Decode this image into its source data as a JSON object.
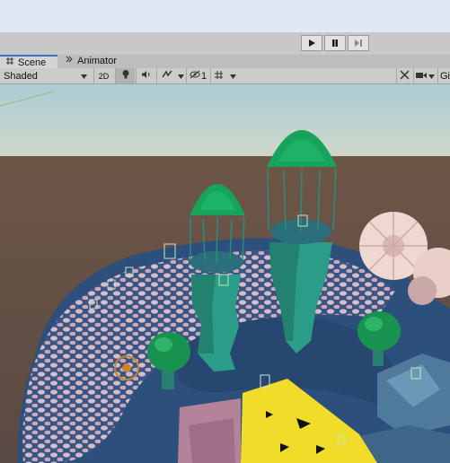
{
  "playbar": {
    "play_icon": "play-icon",
    "pause_icon": "pause-icon",
    "step_icon": "step-icon"
  },
  "tabs": [
    {
      "label": "Scene",
      "icon": "scene-grid-icon"
    },
    {
      "label": "Animator",
      "icon": "animator-icon"
    }
  ],
  "toolbar": {
    "shading_mode": "Shaded",
    "toggle_2d": "2D",
    "hidden_count": "1",
    "gizmos_label": "Gi"
  },
  "colors": {
    "sky": "#b9d0d4",
    "ground": "#6b5545",
    "platform": "#2c4f7c",
    "tower": "#2a9c87",
    "canopy": "#18a35a",
    "yellow_mat": "#f2dc2a"
  }
}
